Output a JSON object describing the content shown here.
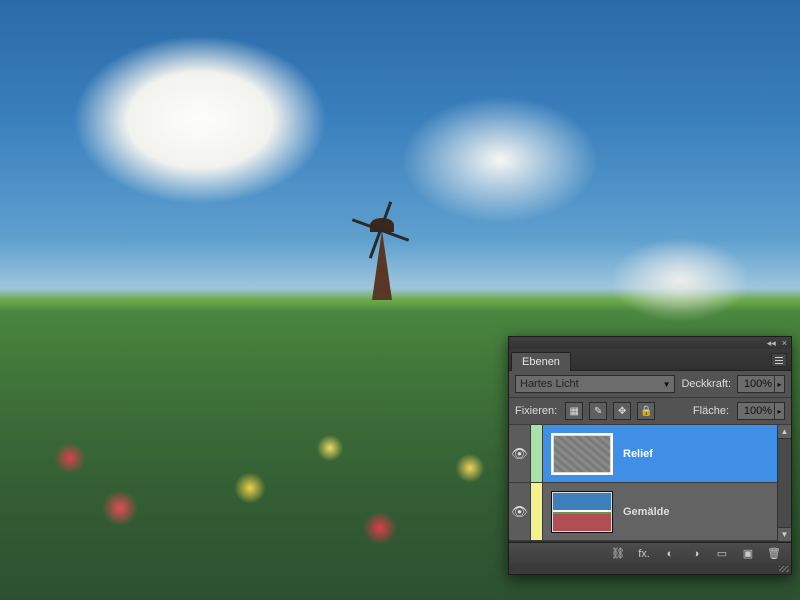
{
  "panel": {
    "tab_label": "Ebenen",
    "blend_mode": "Hartes Licht",
    "opacity_label": "Deckkraft:",
    "opacity_value": "100%",
    "lock_label": "Fixieren:",
    "fill_label": "Fläche:",
    "fill_value": "100%"
  },
  "layers": [
    {
      "name": "Relief",
      "color": "#a7e3a7",
      "selected": true,
      "thumb": "relief"
    },
    {
      "name": "Gemälde",
      "color": "#f3f18a",
      "selected": false,
      "thumb": "painting"
    }
  ],
  "icons": {
    "collapse": "◂◂",
    "close": "×",
    "menu": "≡",
    "dropdown": "▼",
    "stepper": "▸",
    "lock_pixels": "▦",
    "lock_brush": "✎",
    "lock_move": "✥",
    "lock_all": "🔒",
    "eye": "👁",
    "link": "⛓",
    "fx": "fx.",
    "mask": "◐",
    "adjust": "◑",
    "group": "▭",
    "new": "▣",
    "trash": "🗑",
    "scroll_up": "▲",
    "scroll_down": "▼"
  }
}
